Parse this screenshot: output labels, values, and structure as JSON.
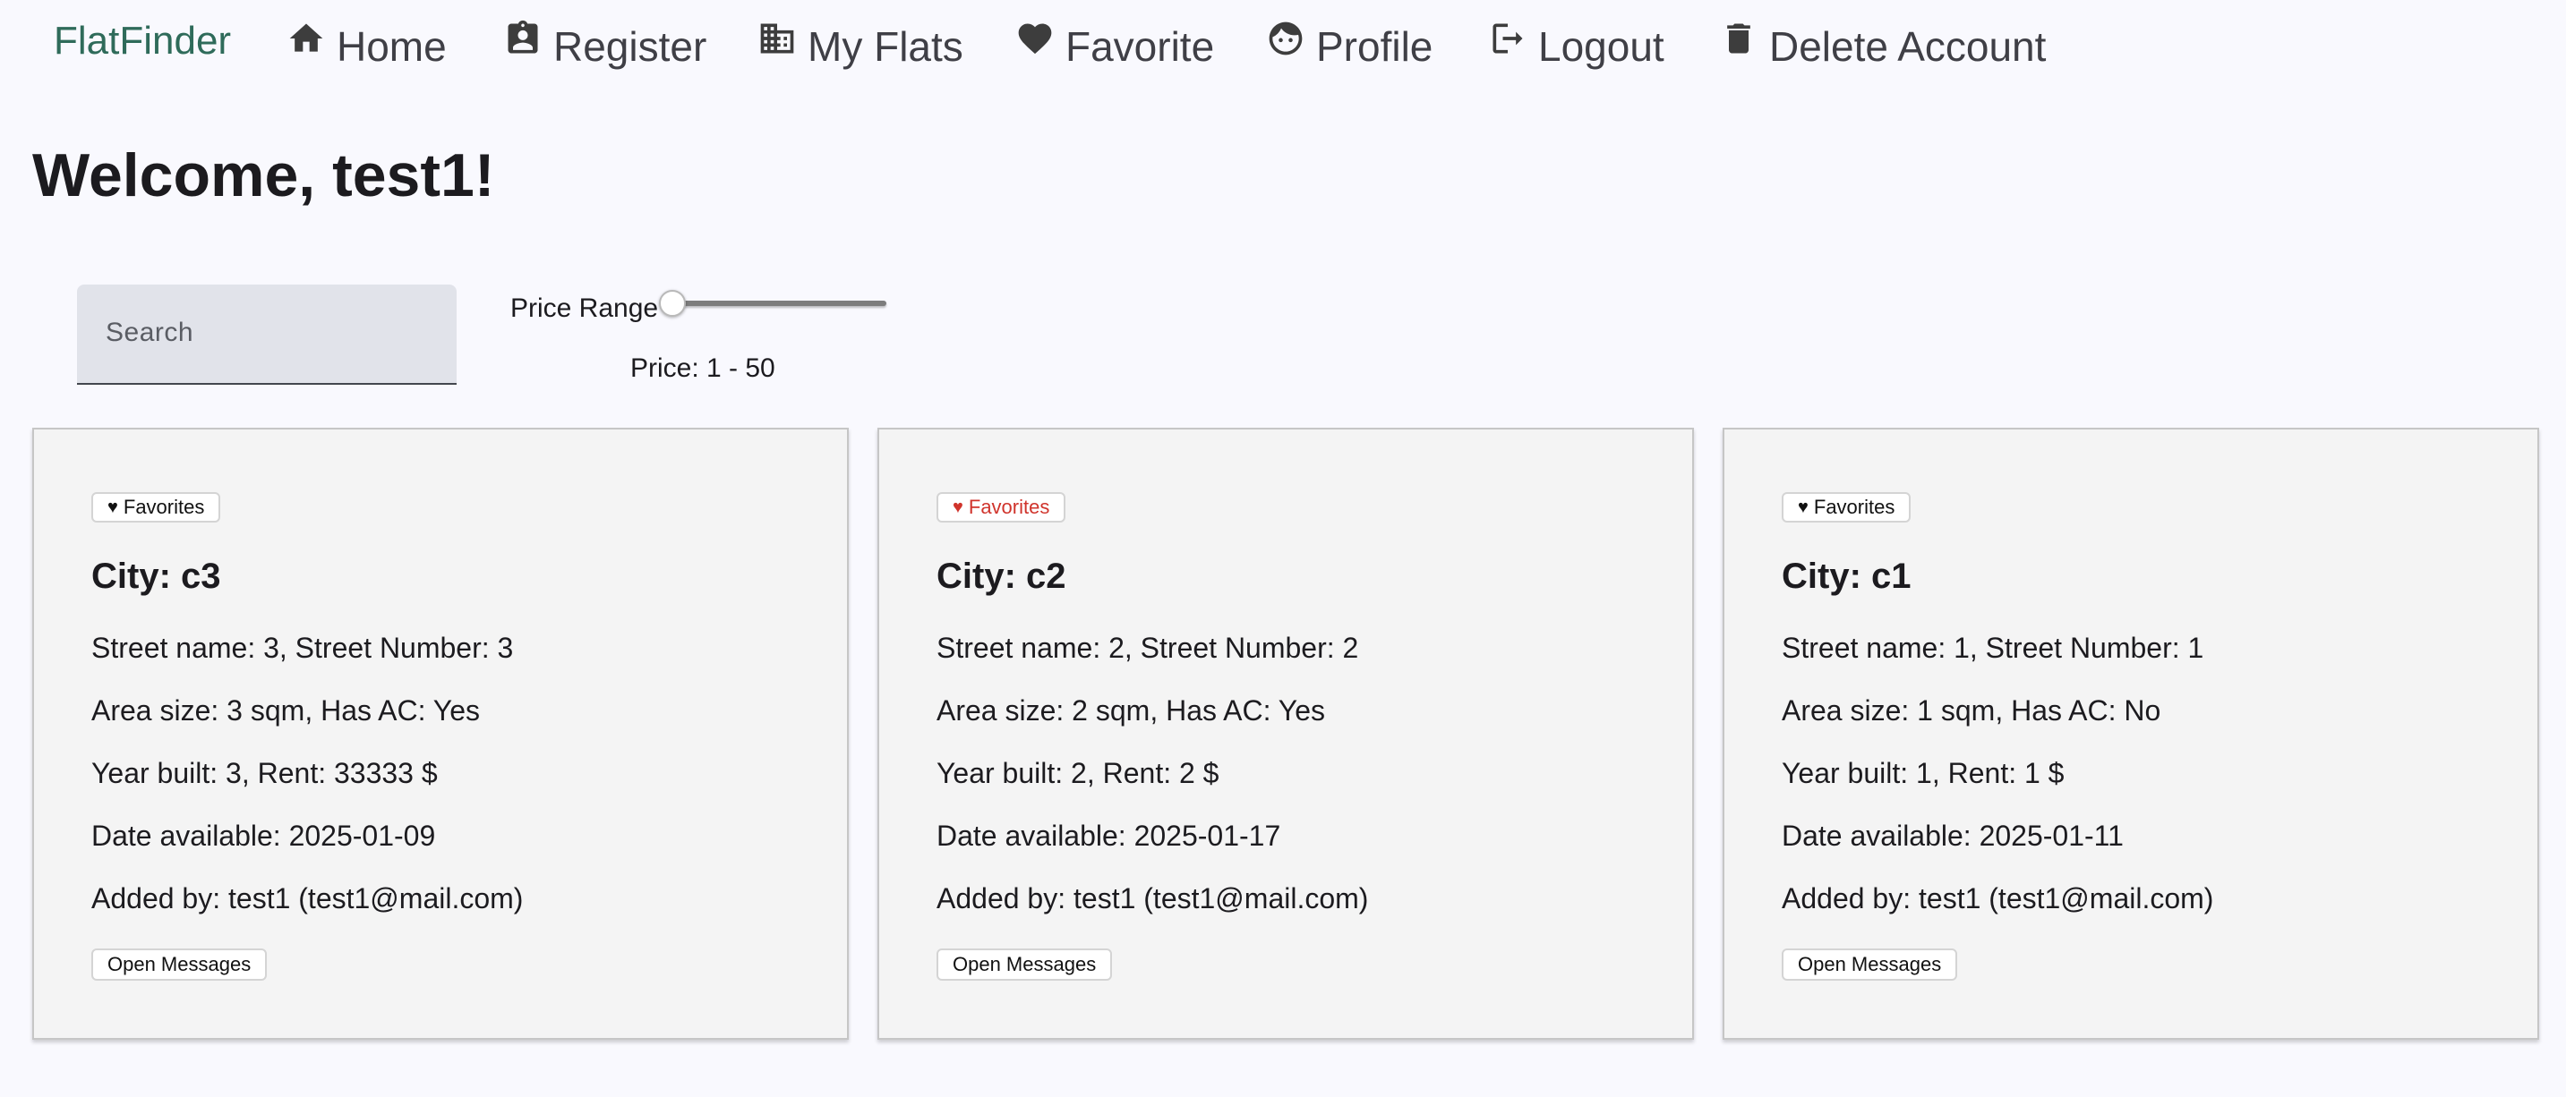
{
  "app": {
    "brand": "FlatFinder"
  },
  "nav": {
    "items": [
      {
        "label": "Home",
        "icon": "home-icon"
      },
      {
        "label": "Register",
        "icon": "badge-icon"
      },
      {
        "label": "My Flats",
        "icon": "building-icon"
      },
      {
        "label": "Favorite",
        "icon": "heart-icon"
      },
      {
        "label": "Profile",
        "icon": "face-icon"
      },
      {
        "label": "Logout",
        "icon": "logout-icon"
      },
      {
        "label": "Delete Account",
        "icon": "trash-icon"
      }
    ]
  },
  "main": {
    "welcome": "Welcome, test1!"
  },
  "filters": {
    "search_placeholder": "Search",
    "search_value": "",
    "price_range_label": "Price Range",
    "price_text": "Price: 1 - 50",
    "slider_value": 0
  },
  "colors": {
    "brand": "#2f6b5a",
    "favorite_active": "#d0342c",
    "card_background": "#f4f4f4",
    "page_background": "#f9f9fe"
  },
  "flats": [
    {
      "favorite_label": "Favorites",
      "favorite_active": false,
      "city": "City: c3",
      "street": "Street name: 3, Street Number: 3",
      "area": "Area size: 3 sqm, Has AC: Yes",
      "year_rent": "Year built: 3, Rent: 33333 $",
      "date": "Date available: 2025-01-09",
      "added_by": "Added by: test1 (test1@mail.com)",
      "messages_label": "Open Messages"
    },
    {
      "favorite_label": "Favorites",
      "favorite_active": true,
      "city": "City: c2",
      "street": "Street name: 2, Street Number: 2",
      "area": "Area size: 2 sqm, Has AC: Yes",
      "year_rent": "Year built: 2, Rent: 2 $",
      "date": "Date available: 2025-01-17",
      "added_by": "Added by: test1 (test1@mail.com)",
      "messages_label": "Open Messages"
    },
    {
      "favorite_label": "Favorites",
      "favorite_active": false,
      "city": "City: c1",
      "street": "Street name: 1, Street Number: 1",
      "area": "Area size: 1 sqm, Has AC: No",
      "year_rent": "Year built: 1, Rent: 1 $",
      "date": "Date available: 2025-01-11",
      "added_by": "Added by: test1 (test1@mail.com)",
      "messages_label": "Open Messages"
    }
  ]
}
